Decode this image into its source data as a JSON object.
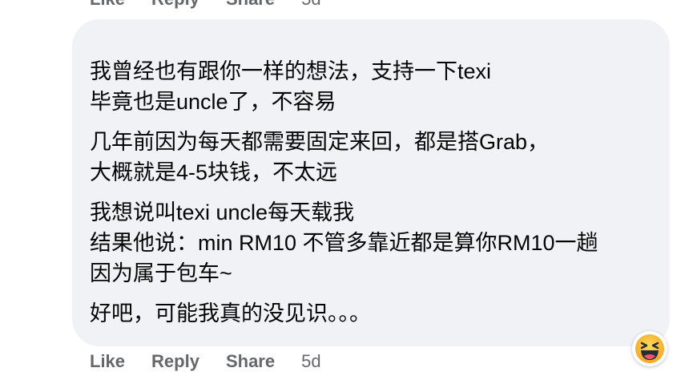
{
  "top_actions": {
    "like": "Like",
    "reply": "Reply",
    "share": "Share",
    "time": "5d"
  },
  "comment": {
    "paragraphs": [
      [
        "我曾经也有跟你一样的想法，支持一下texi",
        "毕竟也是uncle了，不容易"
      ],
      [
        "几年前因为每天都需要固定来回，都是搭Grab，",
        "大概就是4-5块钱，不太远"
      ],
      [
        "我想说叫texi uncle每天载我",
        "结果他说：min RM10 不管多靠近都是算你RM10一趟",
        "因为属于包车~"
      ],
      [
        "好吧，可能我真的没见识。。。"
      ]
    ]
  },
  "reaction": {
    "icon": "haha-reaction-icon"
  },
  "bottom_actions": {
    "like": "Like",
    "reply": "Reply",
    "share": "Share",
    "time": "5d"
  },
  "colors": {
    "bubble": "#f0f2f5",
    "action_text": "#65676b",
    "text": "#050505",
    "reaction_yellow": "#f7b125"
  }
}
